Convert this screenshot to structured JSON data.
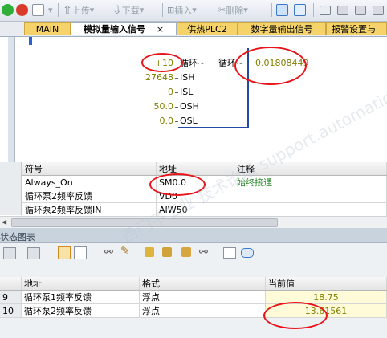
{
  "toolbar": {
    "upload_label": "上传",
    "download_label": "下载",
    "insert_label": "插入",
    "delete_label": "删除"
  },
  "tabs": [
    {
      "label": "MAIN"
    },
    {
      "label": "模拟量输入信号",
      "close": "×"
    },
    {
      "label": "供热PLC2"
    },
    {
      "label": "数字量输出信号"
    },
    {
      "label": "报警设置与"
    }
  ],
  "fbd": {
    "pins": [
      {
        "value": "+10",
        "name": "循环~"
      },
      {
        "value": "27648",
        "name": "ISH"
      },
      {
        "value": "0",
        "name": "ISL"
      },
      {
        "value": "50.0",
        "name": "OSH"
      },
      {
        "value": "0.0",
        "name": "OSL"
      }
    ],
    "out_name": "循环~",
    "out_value": "0.01808449"
  },
  "symbol_table": {
    "headers": [
      "符号",
      "地址",
      "注释"
    ],
    "rows": [
      {
        "symbol": "Always_On",
        "address": "SM0.0",
        "comment": "始终接通"
      },
      {
        "symbol": "循环泵2频率反馈",
        "address": "VD0",
        "comment": ""
      },
      {
        "symbol": "循环泵2频率反馈IN",
        "address": "AIW50",
        "comment": ""
      }
    ]
  },
  "status_panel": {
    "title": "状态图表",
    "headers": [
      "",
      "地址",
      "格式",
      "当前值"
    ],
    "rows": [
      {
        "index": "9",
        "address": "循环泵1频率反馈",
        "format": "浮点",
        "value": "18.75"
      },
      {
        "index": "10",
        "address": "循环泵2频率反馈",
        "format": "浮点",
        "value": "13.61561"
      }
    ]
  },
  "watermark": "西门子工业 技术论坛 support.automation.siemens.com/cs",
  "colors": {
    "value_text": "#808000",
    "annotation_red": "#e8141a",
    "tab_yellow": "#f5d36a"
  }
}
